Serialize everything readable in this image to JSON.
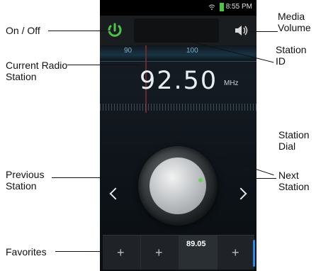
{
  "status": {
    "time": "8:55 PM"
  },
  "tuner": {
    "scale_labels": [
      "90",
      "100"
    ],
    "frequency": "92.50",
    "unit": "MHz"
  },
  "favorites": {
    "slots": [
      "+",
      "+",
      "89.05",
      "+"
    ]
  },
  "labels": {
    "on_off": "On / Off",
    "current_radio_station": "Current Radio\nStation",
    "previous_station": "Previous\nStation",
    "favorites": "Favorites",
    "media_volume": "Media\nVolume",
    "station_id": "Station\nID",
    "station_dial": "Station\nDial",
    "next_station": "Next\nStation"
  },
  "colors": {
    "power_green": "#4fc24a",
    "accent_blue": "#2d8be7",
    "dial_indicator": "#69d15a"
  },
  "icons": {
    "power": "power-icon",
    "volume": "speaker-icon",
    "previous": "chevron-left-icon",
    "next": "chevron-right-icon",
    "add": "plus-icon"
  }
}
